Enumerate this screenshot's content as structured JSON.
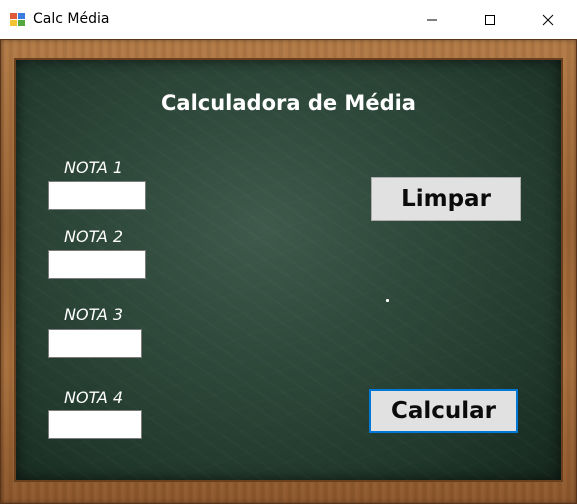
{
  "window": {
    "title": "Calc Média",
    "controls": [
      "minimize",
      "maximize",
      "close"
    ]
  },
  "form": {
    "heading": "Calculadora de Média",
    "fields": [
      {
        "label": "NOTA 1",
        "value": ""
      },
      {
        "label": "NOTA 2",
        "value": ""
      },
      {
        "label": "NOTA 3",
        "value": ""
      },
      {
        "label": "NOTA 4",
        "value": ""
      }
    ],
    "result_text": ".",
    "buttons": {
      "clear_label": "Limpar",
      "calculate_label": "Calcular"
    }
  },
  "colors": {
    "board": "#2f4a3c",
    "frame": "#9a6334",
    "focus_border": "#0078d7",
    "button_bg": "#e1e1e1"
  }
}
